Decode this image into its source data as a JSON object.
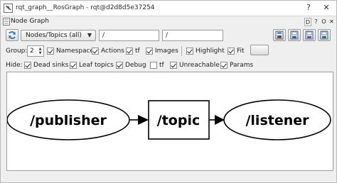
{
  "window": {
    "title": "rqt_graph__RosGraph - rqt@d2d8d5e37254",
    "buttons": {
      "help": "?",
      "close": "✕"
    }
  },
  "dock": {
    "title": "Node Graph",
    "buttons": {
      "d": "D",
      "help": "?",
      "options": "O",
      "close": "✕"
    }
  },
  "toolbar": {
    "refresh_icon": "refresh-icon",
    "mode_select": "Nodes/Topics (all)",
    "node_filter": "/",
    "topic_filter": "/",
    "icons": [
      "load-dot-icon",
      "save-dot-icon",
      "save-svg-icon",
      "screenshot-icon"
    ]
  },
  "options_row": {
    "group_label": "Group:",
    "group_value": "2",
    "items": [
      {
        "label": "Namespaces",
        "checked": true
      },
      {
        "label": "Actions",
        "checked": true
      },
      {
        "label": "tf",
        "checked": true
      },
      {
        "label": "Images",
        "checked": true
      },
      {
        "label": "Highlight",
        "checked": true
      },
      {
        "label": "Fit",
        "checked": true
      }
    ]
  },
  "hide_row": {
    "hide_label": "Hide:",
    "items": [
      {
        "label": "Dead sinks",
        "checked": true
      },
      {
        "label": "Leaf topics",
        "checked": true
      },
      {
        "label": "Debug",
        "checked": true
      },
      {
        "label": "tf",
        "checked": false
      },
      {
        "label": "Unreachable",
        "checked": true
      },
      {
        "label": "Params",
        "checked": true
      }
    ]
  },
  "graph": {
    "publisher": "/publisher",
    "topic": "/topic",
    "listener": "/listener"
  }
}
